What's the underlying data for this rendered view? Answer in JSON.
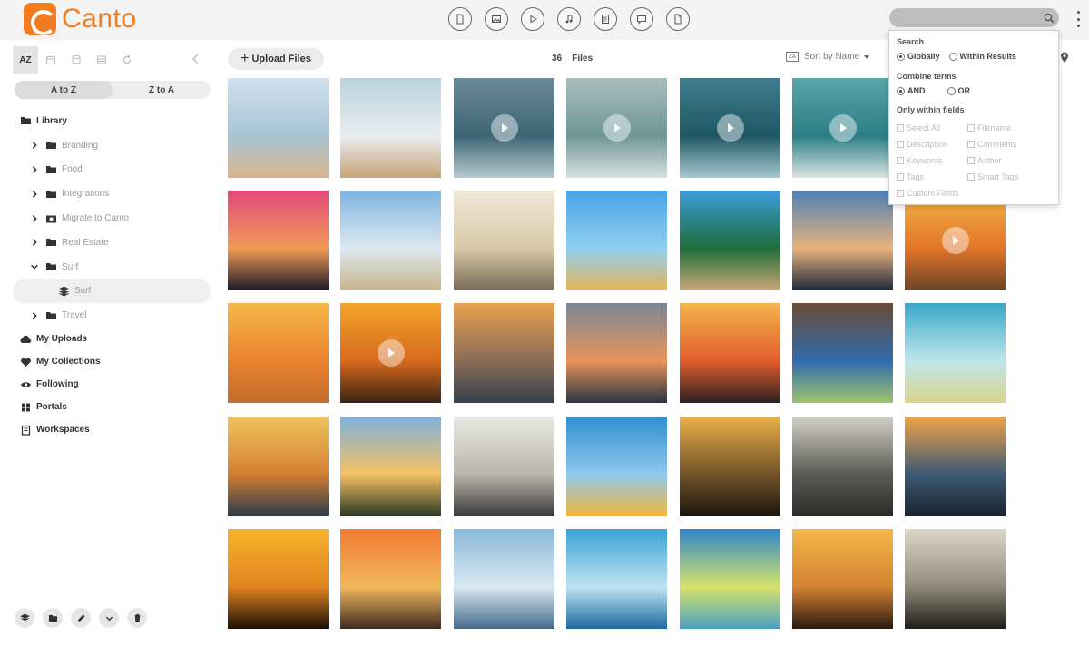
{
  "app": {
    "name": "Canto",
    "brand_color": "#f47b20"
  },
  "toolbar": {
    "type_filters": [
      "document-icon",
      "image-icon",
      "video-icon",
      "audio-icon",
      "presentation-icon",
      "chat-icon",
      "other-file-icon"
    ],
    "search_placeholder": ""
  },
  "sidebar": {
    "tools": {
      "az_label": "AZ"
    },
    "sort": {
      "a_to_z": "A to Z",
      "z_to_a": "Z to A"
    },
    "library_label": "Library",
    "folders": [
      {
        "label": "Branding",
        "icon": "folder-icon",
        "open": false
      },
      {
        "label": "Food",
        "icon": "folder-icon",
        "open": false
      },
      {
        "label": "Integrations",
        "icon": "folder-icon",
        "open": false
      },
      {
        "label": "Migrate to Canto",
        "icon": "camera-folder-icon",
        "open": false
      },
      {
        "label": "Real Estate",
        "icon": "folder-icon",
        "open": false
      },
      {
        "label": "Surf",
        "icon": "folder-icon",
        "open": true
      },
      {
        "label": "Surf",
        "icon": "album-icon",
        "child": true,
        "selected": true
      },
      {
        "label": "Travel",
        "icon": "folder-icon",
        "open": false
      }
    ],
    "sections": [
      {
        "label": "My Uploads",
        "icon": "upload-cloud-icon"
      },
      {
        "label": "My Collections",
        "icon": "heart-icon"
      },
      {
        "label": "Following",
        "icon": "eye-icon"
      },
      {
        "label": "Portals",
        "icon": "grid-icon"
      },
      {
        "label": "Workspaces",
        "icon": "workspace-icon"
      }
    ]
  },
  "content": {
    "upload_label": "Upload Files",
    "file_count": "36",
    "files_label": "Files",
    "sort_label": "Sort by Name"
  },
  "search_panel": {
    "search_heading": "Search",
    "globally": "Globally",
    "within_results": "Within Results",
    "combine_heading": "Combine terms",
    "and_label": "AND",
    "or_label": "OR",
    "fields_heading": "Only within fields",
    "fields_left": [
      "Select All",
      "Description",
      "Keywords",
      "Tags",
      "Custom Fields"
    ],
    "fields_right": [
      "Filename",
      "Comments",
      "Author",
      "Smart Tags"
    ]
  },
  "thumbnails": [
    {
      "video": false,
      "palette": [
        "#cfe2ee",
        "#a7c4d4",
        "#d9b48a"
      ]
    },
    {
      "video": false,
      "palette": [
        "#b9d2dc",
        "#e8eef0",
        "#c9a277"
      ]
    },
    {
      "video": true,
      "palette": [
        "#6c8a99",
        "#3d6474",
        "#b8cad0"
      ]
    },
    {
      "video": true,
      "palette": [
        "#a9bdbd",
        "#6f9797",
        "#d7e0dc"
      ]
    },
    {
      "video": true,
      "palette": [
        "#3f7d8e",
        "#1f5865",
        "#a6c9cf"
      ]
    },
    {
      "video": true,
      "palette": [
        "#5aa6a9",
        "#2c7d86",
        "#d9e6e3"
      ]
    },
    {
      "video": false,
      "palette": [
        "#d9e8ef",
        "#9bbcc7",
        "#7d6f60"
      ]
    },
    {
      "video": false,
      "palette": [
        "#e24a7a",
        "#f29a55",
        "#1e1b2a"
      ]
    },
    {
      "video": false,
      "palette": [
        "#7fb4df",
        "#dce9f1",
        "#c9b48b"
      ]
    },
    {
      "video": false,
      "palette": [
        "#f1ead8",
        "#d8c8a6",
        "#7a6b58"
      ]
    },
    {
      "video": false,
      "palette": [
        "#4aa3e6",
        "#8fd0f1",
        "#e3b55a"
      ]
    },
    {
      "video": false,
      "palette": [
        "#3d9cdb",
        "#1f6e3a",
        "#c9a574"
      ]
    },
    {
      "video": false,
      "palette": [
        "#4f7fb5",
        "#e7b37d",
        "#1d2a3b"
      ]
    },
    {
      "video": true,
      "palette": [
        "#f3b447",
        "#e2752a",
        "#6b4526"
      ]
    },
    {
      "video": false,
      "palette": [
        "#f7b74a",
        "#e8832e",
        "#c56b2c"
      ]
    },
    {
      "video": true,
      "palette": [
        "#f2a42c",
        "#d86a1d",
        "#3a2314"
      ]
    },
    {
      "video": false,
      "palette": [
        "#e9a14e",
        "#8a6c57",
        "#36424d"
      ]
    },
    {
      "video": false,
      "palette": [
        "#7a8795",
        "#e7955a",
        "#2a3440"
      ]
    },
    {
      "video": false,
      "palette": [
        "#f3b54b",
        "#e15d2c",
        "#2b2020"
      ]
    },
    {
      "video": false,
      "palette": [
        "#6b4a34",
        "#2f6cae",
        "#9cc46b"
      ]
    },
    {
      "video": false,
      "palette": [
        "#3aa6c9",
        "#bfe6ea",
        "#d9d38b"
      ]
    },
    {
      "video": false,
      "palette": [
        "#f1c45c",
        "#d27f32",
        "#2c3b49"
      ]
    },
    {
      "video": false,
      "palette": [
        "#7fb2de",
        "#f4c062",
        "#2a3a24"
      ]
    },
    {
      "video": false,
      "palette": [
        "#e9e9e4",
        "#b9b5aa",
        "#3a3a3a"
      ]
    },
    {
      "video": false,
      "palette": [
        "#2f8fd1",
        "#8fc9ec",
        "#f2b43c"
      ]
    },
    {
      "video": false,
      "palette": [
        "#e9b04a",
        "#735228",
        "#1b150d"
      ]
    },
    {
      "video": false,
      "palette": [
        "#d3d0c6",
        "#5a5a56",
        "#2a2a28"
      ]
    },
    {
      "video": false,
      "palette": [
        "#f0a347",
        "#3d5a74",
        "#1a2430"
      ]
    },
    {
      "video": false,
      "palette": [
        "#f7b32a",
        "#e0841d",
        "#1a1006"
      ]
    },
    {
      "video": false,
      "palette": [
        "#f07a32",
        "#f2b85c",
        "#3e2b22"
      ]
    },
    {
      "video": false,
      "palette": [
        "#8ab7d9",
        "#d9e9f2",
        "#436a8a"
      ]
    },
    {
      "video": false,
      "palette": [
        "#3aa2d8",
        "#bfe3f0",
        "#1f6aa0"
      ]
    },
    {
      "video": false,
      "palette": [
        "#2e86c8",
        "#d6e36b",
        "#4aa0c0"
      ]
    },
    {
      "video": false,
      "palette": [
        "#f4b74a",
        "#d48232",
        "#2a1a10"
      ]
    },
    {
      "video": false,
      "palette": [
        "#dcd8c7",
        "#8f8a79",
        "#1e1e1a"
      ]
    }
  ]
}
